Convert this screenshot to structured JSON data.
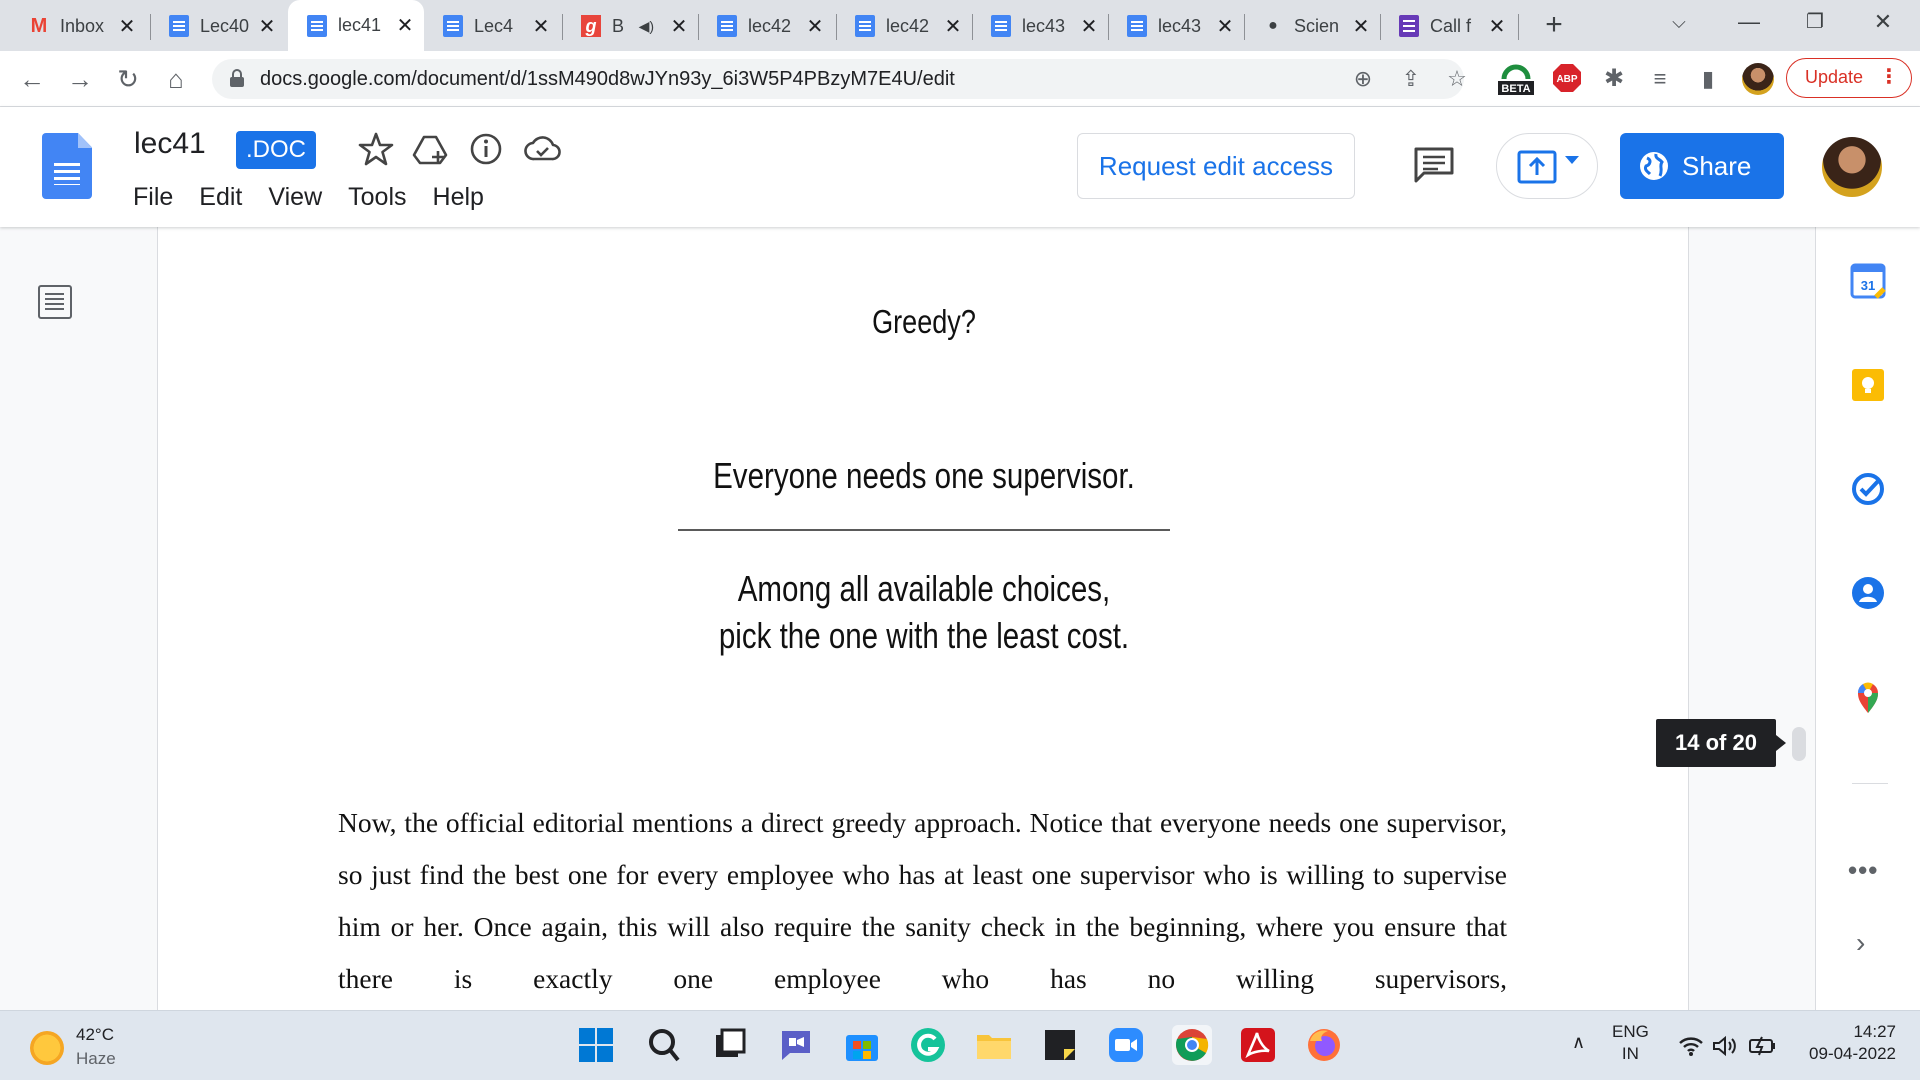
{
  "browser": {
    "tabs": [
      {
        "title": "Inbox",
        "favicon": "gmail-icon"
      },
      {
        "title": "Lec40",
        "favicon": "docs-icon"
      },
      {
        "title": "lec41",
        "favicon": "docs-icon",
        "active": true
      },
      {
        "title": "Lec4",
        "favicon": "docs-icon"
      },
      {
        "title": "B",
        "favicon": "g-icon",
        "audio": true
      },
      {
        "title": "lec42",
        "favicon": "docs-icon"
      },
      {
        "title": "lec42",
        "favicon": "docs-icon"
      },
      {
        "title": "lec43",
        "favicon": "docs-icon"
      },
      {
        "title": "lec43",
        "favicon": "docs-icon"
      },
      {
        "title": "Scien",
        "favicon": "chat-icon"
      },
      {
        "title": "Call f",
        "favicon": "forms-icon"
      }
    ],
    "url": "docs.google.com/document/d/1ssM490d8wJYn93y_6i3W5P4PBzyM7E4U/edit",
    "update_label": "Update",
    "beta_badge": "BETA",
    "abp_badge": "ABP"
  },
  "docs": {
    "title": "lec41",
    "badge": ".DOC",
    "menu": [
      "File",
      "Edit",
      "View",
      "Tools",
      "Help"
    ],
    "request_edit_label": "Request edit access",
    "share_label": "Share",
    "page_counter": "14 of 20"
  },
  "document": {
    "slide_question": "Greedy?",
    "slide_line1": "Everyone needs one supervisor.",
    "slide_line2": "Among all available choices,",
    "slide_line3": "pick the one with the least cost.",
    "body_paragraph": "Now, the official editorial mentions a direct greedy approach. Notice that everyone needs one supervisor, so just find the best one for every employee who has at least one supervisor who is willing to supervise him or her. Once again, this will also require the sanity check in the beginning, where you ensure that there is exactly one employee who has no willing supervisors,"
  },
  "side_panel": {
    "calendar_day": "31",
    "more_label": "•••",
    "expand_label": "›"
  },
  "taskbar": {
    "temperature": "42°C",
    "condition": "Haze",
    "language_line1": "ENG",
    "language_line2": "IN",
    "time": "14:27",
    "date": "09-04-2022"
  },
  "colors": {
    "accent": "#1a73e8",
    "update_red": "#d93025",
    "docs_blue": "#4285f4"
  }
}
